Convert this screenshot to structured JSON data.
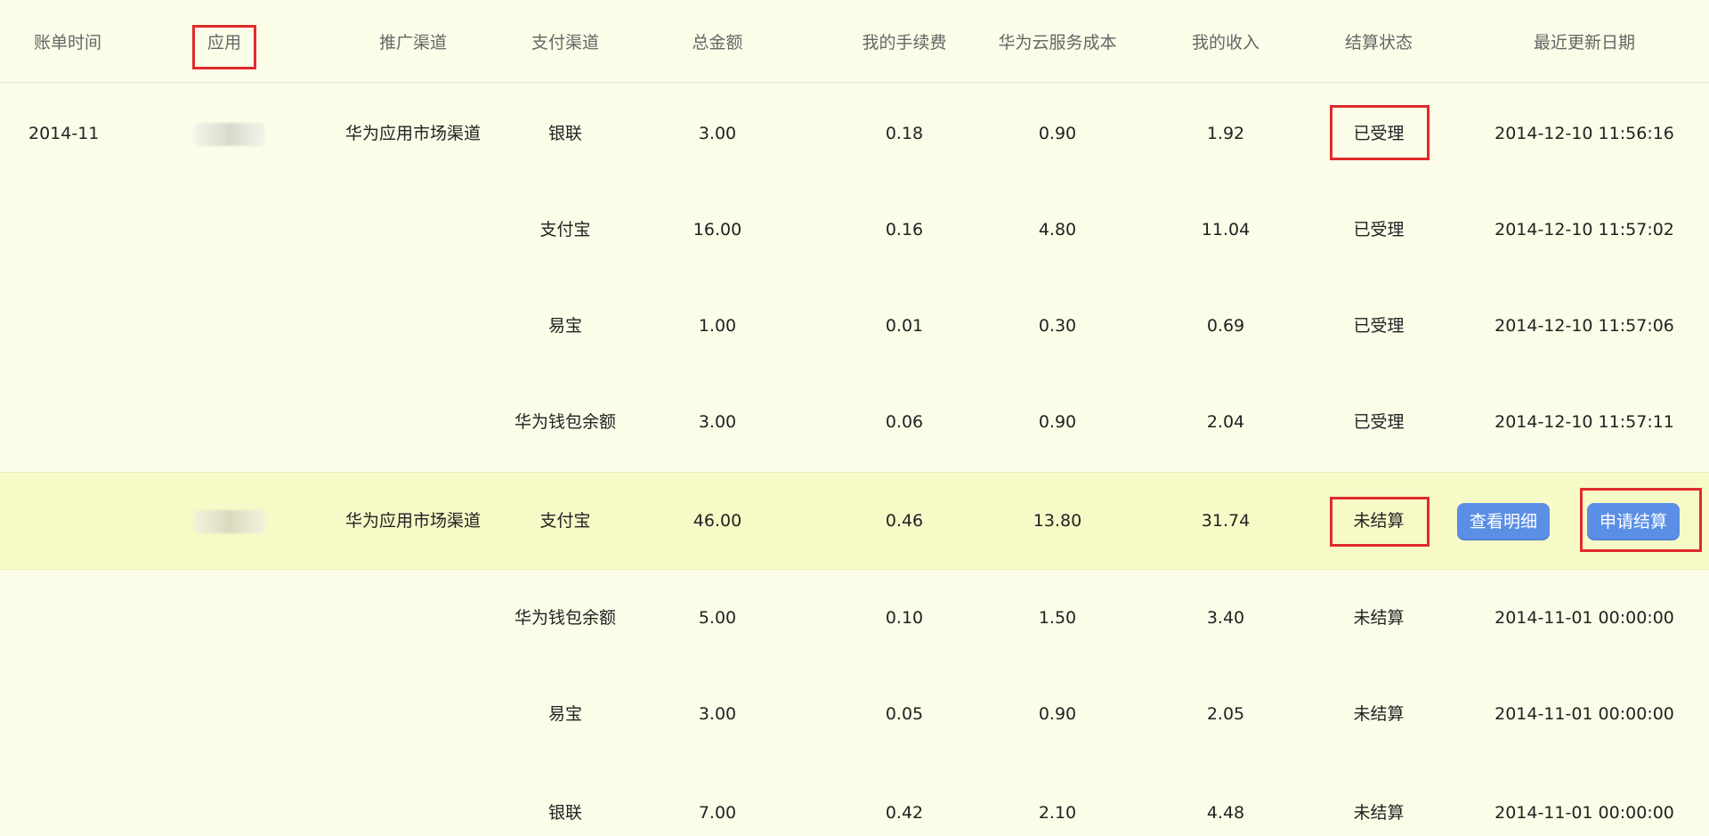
{
  "headers": {
    "bill_time": "账单时间",
    "app": "应用",
    "promo_channel": "推广渠道",
    "pay_channel": "支付渠道",
    "total": "总金额",
    "fee": "我的手续费",
    "cloud_cost": "华为云服务成本",
    "income": "我的收入",
    "status": "结算状态",
    "updated": "最近更新日期"
  },
  "rows": [
    {
      "bill_time": "2014-11",
      "promo_channel": "华为应用市场渠道",
      "pay_channel": "银联",
      "total": "3.00",
      "fee": "0.18",
      "cloud_cost": "0.90",
      "income": "1.92",
      "status": "已受理",
      "updated": "2014-12-10 11:56:16"
    },
    {
      "bill_time": "",
      "promo_channel": "",
      "pay_channel": "支付宝",
      "total": "16.00",
      "fee": "0.16",
      "cloud_cost": "4.80",
      "income": "11.04",
      "status": "已受理",
      "updated": "2014-12-10 11:57:02"
    },
    {
      "bill_time": "",
      "promo_channel": "",
      "pay_channel": "易宝",
      "total": "1.00",
      "fee": "0.01",
      "cloud_cost": "0.30",
      "income": "0.69",
      "status": "已受理",
      "updated": "2014-12-10 11:57:06"
    },
    {
      "bill_time": "",
      "promo_channel": "",
      "pay_channel": "华为钱包余额",
      "total": "3.00",
      "fee": "0.06",
      "cloud_cost": "0.90",
      "income": "2.04",
      "status": "已受理",
      "updated": "2014-12-10 11:57:11"
    },
    {
      "bill_time": "",
      "promo_channel": "华为应用市场渠道",
      "pay_channel": "支付宝",
      "total": "46.00",
      "fee": "0.46",
      "cloud_cost": "13.80",
      "income": "31.74",
      "status": "未结算",
      "updated": ""
    },
    {
      "bill_time": "",
      "promo_channel": "",
      "pay_channel": "华为钱包余额",
      "total": "5.00",
      "fee": "0.10",
      "cloud_cost": "1.50",
      "income": "3.40",
      "status": "未结算",
      "updated": "2014-11-01 00:00:00"
    },
    {
      "bill_time": "",
      "promo_channel": "",
      "pay_channel": "易宝",
      "total": "3.00",
      "fee": "0.05",
      "cloud_cost": "0.90",
      "income": "2.05",
      "status": "未结算",
      "updated": "2014-11-01 00:00:00"
    },
    {
      "bill_time": "",
      "promo_channel": "",
      "pay_channel": "银联",
      "total": "7.00",
      "fee": "0.42",
      "cloud_cost": "2.10",
      "income": "4.48",
      "status": "未结算",
      "updated": "2014-11-01 00:00:00"
    }
  ],
  "actions": {
    "view_details": "查看明细",
    "apply_settlement": "申请结算"
  },
  "colors": {
    "background": "#fbfde8",
    "highlight_row": "#f7f9c7",
    "button": "#5b8fe6",
    "annotation_box": "#e02b2b"
  }
}
